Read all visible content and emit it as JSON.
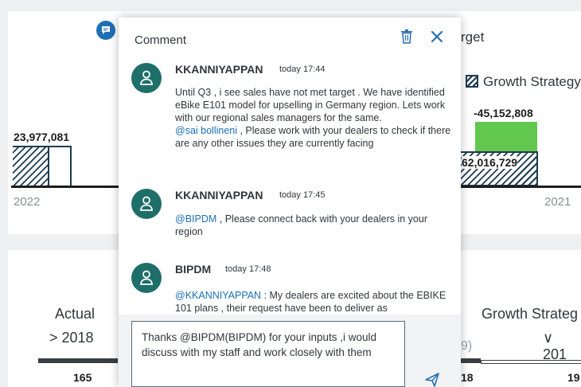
{
  "background": {
    "top_chart": {
      "value_left": "23,977,081",
      "year_left": "2022",
      "title_fragment": "rget",
      "legend_label": "Growth Strategy",
      "value_green": "-45,152,808",
      "value_hatched": "62,016,729",
      "year_right": "2021"
    },
    "bottom": {
      "actual_label": "Actual",
      "actual_year": "> 2018",
      "actual_value": "165",
      "paren_fragment": "9)",
      "growth_label": "Growth Strateg",
      "growth_year": "∨ 201",
      "value_mid": "18",
      "value_right": "19"
    }
  },
  "dialog": {
    "title": "Comment",
    "delete_icon": "trash-icon",
    "close_icon": "close-icon",
    "comments": [
      {
        "author": "KKANNIYAPPAN",
        "time": "today 17:44",
        "text": "Until Q3 , i see sales have not met target . We have identified eBike E101 model for upselling in Germany region. Lets work with our regional sales managers for the same.",
        "mention": "@sai bollineni",
        "text_after": " , Please work with your dealers to check if there are any other issues they are currently facing"
      },
      {
        "author": "KKANNIYAPPAN",
        "time": "today 17:45",
        "mention": "@BIPDM",
        "text_after": " , Please connect back with your dealers in your region"
      },
      {
        "author": "BIPDM",
        "time": "today 17:48",
        "mention": "@KKANNIYAPPAN",
        "text_after": " : My dealers are excited about the EBIKE 101 plans , their request have been to deliver as"
      }
    ],
    "input_value": "Thanks @BIPDM(BIPDM) for your inputs ,i would discuss with my staff and work closely with them",
    "send_icon": "send-icon"
  },
  "colors": {
    "accent": "#1a6fb6",
    "avatar": "#1e6e6a",
    "green_bar": "#61c74f",
    "hatch": "#1d3b4f"
  }
}
